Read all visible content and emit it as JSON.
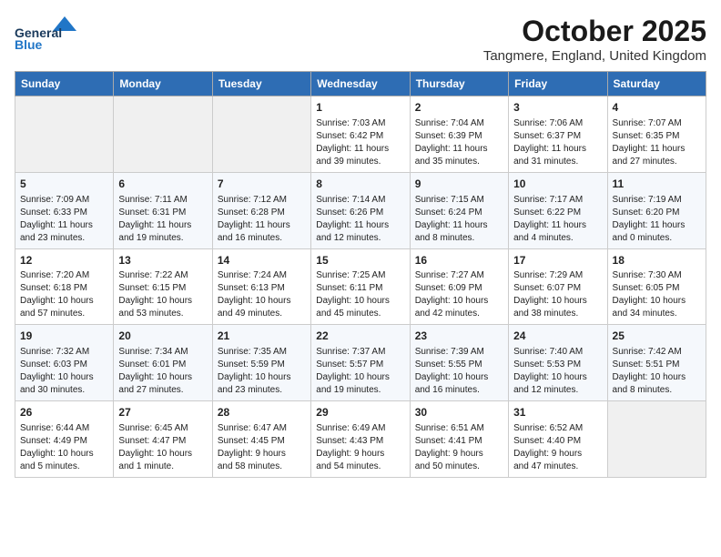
{
  "logo": {
    "line1": "General",
    "line2": "Blue"
  },
  "title": "October 2025",
  "location": "Tangmere, England, United Kingdom",
  "days_of_week": [
    "Sunday",
    "Monday",
    "Tuesday",
    "Wednesday",
    "Thursday",
    "Friday",
    "Saturday"
  ],
  "weeks": [
    [
      {
        "day": "",
        "info": ""
      },
      {
        "day": "",
        "info": ""
      },
      {
        "day": "",
        "info": ""
      },
      {
        "day": "1",
        "info": "Sunrise: 7:03 AM\nSunset: 6:42 PM\nDaylight: 11 hours\nand 39 minutes."
      },
      {
        "day": "2",
        "info": "Sunrise: 7:04 AM\nSunset: 6:39 PM\nDaylight: 11 hours\nand 35 minutes."
      },
      {
        "day": "3",
        "info": "Sunrise: 7:06 AM\nSunset: 6:37 PM\nDaylight: 11 hours\nand 31 minutes."
      },
      {
        "day": "4",
        "info": "Sunrise: 7:07 AM\nSunset: 6:35 PM\nDaylight: 11 hours\nand 27 minutes."
      }
    ],
    [
      {
        "day": "5",
        "info": "Sunrise: 7:09 AM\nSunset: 6:33 PM\nDaylight: 11 hours\nand 23 minutes."
      },
      {
        "day": "6",
        "info": "Sunrise: 7:11 AM\nSunset: 6:31 PM\nDaylight: 11 hours\nand 19 minutes."
      },
      {
        "day": "7",
        "info": "Sunrise: 7:12 AM\nSunset: 6:28 PM\nDaylight: 11 hours\nand 16 minutes."
      },
      {
        "day": "8",
        "info": "Sunrise: 7:14 AM\nSunset: 6:26 PM\nDaylight: 11 hours\nand 12 minutes."
      },
      {
        "day": "9",
        "info": "Sunrise: 7:15 AM\nSunset: 6:24 PM\nDaylight: 11 hours\nand 8 minutes."
      },
      {
        "day": "10",
        "info": "Sunrise: 7:17 AM\nSunset: 6:22 PM\nDaylight: 11 hours\nand 4 minutes."
      },
      {
        "day": "11",
        "info": "Sunrise: 7:19 AM\nSunset: 6:20 PM\nDaylight: 11 hours\nand 0 minutes."
      }
    ],
    [
      {
        "day": "12",
        "info": "Sunrise: 7:20 AM\nSunset: 6:18 PM\nDaylight: 10 hours\nand 57 minutes."
      },
      {
        "day": "13",
        "info": "Sunrise: 7:22 AM\nSunset: 6:15 PM\nDaylight: 10 hours\nand 53 minutes."
      },
      {
        "day": "14",
        "info": "Sunrise: 7:24 AM\nSunset: 6:13 PM\nDaylight: 10 hours\nand 49 minutes."
      },
      {
        "day": "15",
        "info": "Sunrise: 7:25 AM\nSunset: 6:11 PM\nDaylight: 10 hours\nand 45 minutes."
      },
      {
        "day": "16",
        "info": "Sunrise: 7:27 AM\nSunset: 6:09 PM\nDaylight: 10 hours\nand 42 minutes."
      },
      {
        "day": "17",
        "info": "Sunrise: 7:29 AM\nSunset: 6:07 PM\nDaylight: 10 hours\nand 38 minutes."
      },
      {
        "day": "18",
        "info": "Sunrise: 7:30 AM\nSunset: 6:05 PM\nDaylight: 10 hours\nand 34 minutes."
      }
    ],
    [
      {
        "day": "19",
        "info": "Sunrise: 7:32 AM\nSunset: 6:03 PM\nDaylight: 10 hours\nand 30 minutes."
      },
      {
        "day": "20",
        "info": "Sunrise: 7:34 AM\nSunset: 6:01 PM\nDaylight: 10 hours\nand 27 minutes."
      },
      {
        "day": "21",
        "info": "Sunrise: 7:35 AM\nSunset: 5:59 PM\nDaylight: 10 hours\nand 23 minutes."
      },
      {
        "day": "22",
        "info": "Sunrise: 7:37 AM\nSunset: 5:57 PM\nDaylight: 10 hours\nand 19 minutes."
      },
      {
        "day": "23",
        "info": "Sunrise: 7:39 AM\nSunset: 5:55 PM\nDaylight: 10 hours\nand 16 minutes."
      },
      {
        "day": "24",
        "info": "Sunrise: 7:40 AM\nSunset: 5:53 PM\nDaylight: 10 hours\nand 12 minutes."
      },
      {
        "day": "25",
        "info": "Sunrise: 7:42 AM\nSunset: 5:51 PM\nDaylight: 10 hours\nand 8 minutes."
      }
    ],
    [
      {
        "day": "26",
        "info": "Sunrise: 6:44 AM\nSunset: 4:49 PM\nDaylight: 10 hours\nand 5 minutes."
      },
      {
        "day": "27",
        "info": "Sunrise: 6:45 AM\nSunset: 4:47 PM\nDaylight: 10 hours\nand 1 minute."
      },
      {
        "day": "28",
        "info": "Sunrise: 6:47 AM\nSunset: 4:45 PM\nDaylight: 9 hours\nand 58 minutes."
      },
      {
        "day": "29",
        "info": "Sunrise: 6:49 AM\nSunset: 4:43 PM\nDaylight: 9 hours\nand 54 minutes."
      },
      {
        "day": "30",
        "info": "Sunrise: 6:51 AM\nSunset: 4:41 PM\nDaylight: 9 hours\nand 50 minutes."
      },
      {
        "day": "31",
        "info": "Sunrise: 6:52 AM\nSunset: 4:40 PM\nDaylight: 9 hours\nand 47 minutes."
      },
      {
        "day": "",
        "info": ""
      }
    ]
  ]
}
